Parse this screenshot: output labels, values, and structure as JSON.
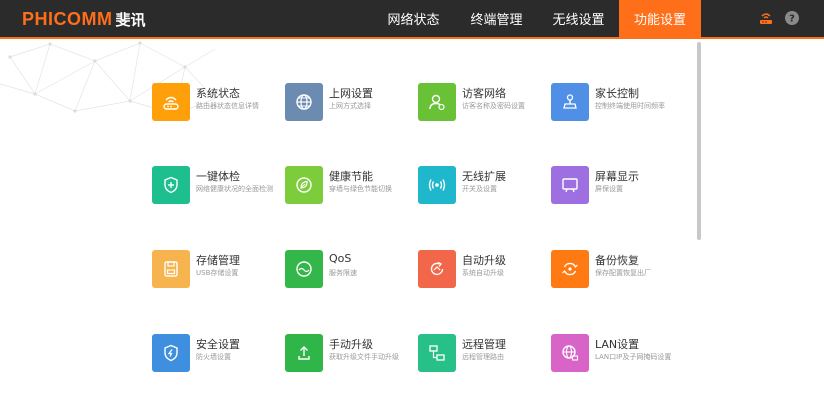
{
  "brand": {
    "name_en": "PHICOMM",
    "name_cn": "斐讯",
    "accent": "#ff6e19"
  },
  "nav": {
    "items": [
      {
        "label": "网络状态"
      },
      {
        "label": "终端管理"
      },
      {
        "label": "无线设置"
      },
      {
        "label": "功能设置",
        "active": true
      }
    ]
  },
  "header_icons": [
    "router-icon",
    "help-icon"
  ],
  "features": [
    {
      "title": "系统状态",
      "desc": "路由器状态信息详情",
      "icon": "router-icon",
      "color": "#ff9f0a"
    },
    {
      "title": "上网设置",
      "desc": "上网方式选择",
      "icon": "globe-icon",
      "color": "#6b8bb0"
    },
    {
      "title": "访客网络",
      "desc": "访客名称及密码设置",
      "icon": "guest-user-icon",
      "color": "#69c236"
    },
    {
      "title": "家长控制",
      "desc": "控制终端使用时间频率",
      "icon": "parental-control-icon",
      "color": "#4f8fe6"
    },
    {
      "title": "一键体检",
      "desc": "网络健康状况的全面检测",
      "icon": "shield-plus-icon",
      "color": "#1dbf8f"
    },
    {
      "title": "健康节能",
      "desc": "穿墙与绿色节能切换",
      "icon": "leaf-icon",
      "color": "#7ccc3c"
    },
    {
      "title": "无线扩展",
      "desc": "开关及设置",
      "icon": "wireless-signal-icon",
      "color": "#1fb7cc"
    },
    {
      "title": "屏幕显示",
      "desc": "屏保设置",
      "icon": "screen-icon",
      "color": "#9d6fe0"
    },
    {
      "title": "存储管理",
      "desc": "USB存储设置",
      "icon": "storage-icon",
      "color": "#f7b44e"
    },
    {
      "title": "QoS",
      "desc": "服务限速",
      "icon": "qos-gauge-icon",
      "color": "#34b74a"
    },
    {
      "title": "自动升级",
      "desc": "系统自动升级",
      "icon": "auto-upgrade-icon",
      "color": "#f2674a"
    },
    {
      "title": "备份恢复",
      "desc": "保存配置恢复出厂",
      "icon": "backup-restore-icon",
      "color": "#ff7a12"
    },
    {
      "title": "安全设置",
      "desc": "防火墙设置",
      "icon": "security-shield-icon",
      "color": "#3f8fe0"
    },
    {
      "title": "手动升级",
      "desc": "获取升级文件手动升级",
      "icon": "manual-upgrade-icon",
      "color": "#2fb548"
    },
    {
      "title": "远程管理",
      "desc": "远程管理路由",
      "icon": "remote-management-icon",
      "color": "#27c088"
    },
    {
      "title": "LAN设置",
      "desc": "LAN口IP及子网掩码设置",
      "icon": "lan-globe-icon",
      "color": "#d964c8"
    }
  ]
}
